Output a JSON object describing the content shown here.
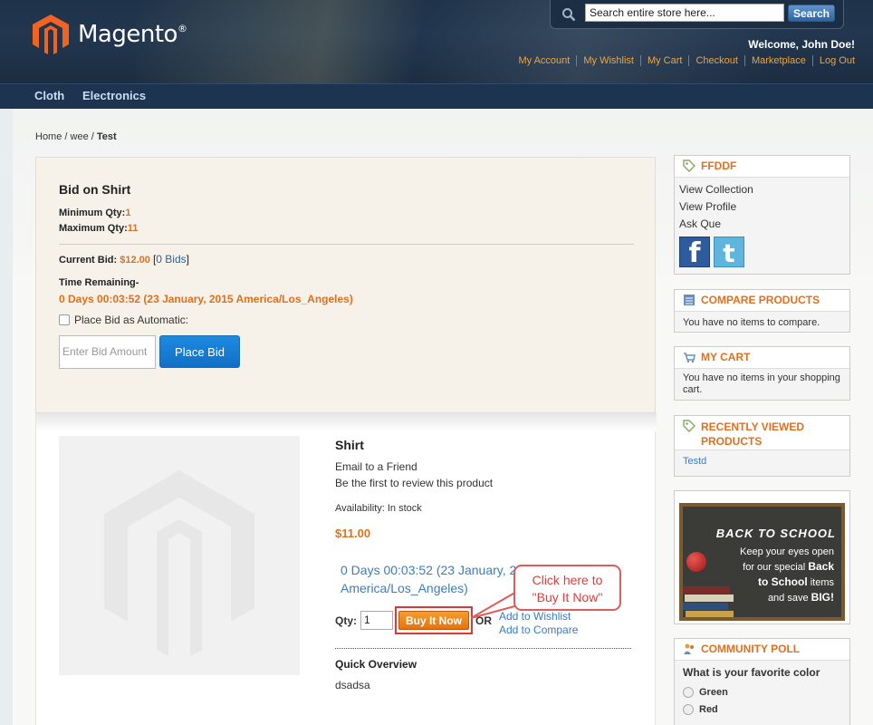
{
  "header": {
    "logo_text": "Magento",
    "logo_mark": "®",
    "search_placeholder": "Search entire store here...",
    "search_button": "Search",
    "welcome": "Welcome, John Doe!",
    "links": [
      "My Account",
      "My Wishlist",
      "My Cart",
      "Checkout",
      "Marketplace",
      "Log Out"
    ]
  },
  "nav": {
    "items": [
      "Cloth",
      "Electronics"
    ]
  },
  "breadcrumb": {
    "home": "Home",
    "sep1": " / ",
    "category": "wee",
    "sep2": " / ",
    "current": "Test"
  },
  "bid": {
    "title": "Bid on Shirt",
    "min_label": "Minimum Qty:",
    "min_value": "1",
    "max_label": "Maximum Qty:",
    "max_value": "11",
    "current_label": "Current Bid:",
    "current_value": "$12.00",
    "bids_open": "[",
    "bids_link": "0 Bids",
    "bids_close": "]",
    "time_label": "Time Remaining-",
    "time_value": "0 Days 00:03:52 (23 January, 2015 America/Los_Angeles)",
    "auto_label": "Place Bid as Automatic:",
    "amount_placeholder": "Enter Bid Amount",
    "place_button": "Place Bid"
  },
  "product": {
    "name": "Shirt",
    "email_friend": "Email to a Friend",
    "review": "Be the first to review this product",
    "availability": "Availability: In stock",
    "price": "$11.00",
    "timer_line1": "0 Days 00:03:52 (23 January, 20",
    "timer_line2": "America/Los_Angeles)",
    "qty_label": "Qty:",
    "qty_value": "1",
    "buy_button": "Buy It Now",
    "or_label": "OR",
    "wishlist_link": "Add to Wishlist",
    "compare_link": "Add to Compare",
    "overview_title": "Quick Overview",
    "overview_text": "dsadsa"
  },
  "callout": {
    "line1": "Click here to",
    "line2": "\"Buy It Now\""
  },
  "sidebar": {
    "seller": {
      "title": "FFDDF",
      "links": [
        "View Collection",
        "View Profile",
        "Ask Que"
      ]
    },
    "compare": {
      "title": "COMPARE PRODUCTS",
      "text": "You have no items to compare."
    },
    "cart": {
      "title": "MY CART",
      "text": "You have no items in your shopping cart."
    },
    "recent": {
      "title": "RECENTLY VIEWED PRODUCTS",
      "item": "Testd"
    },
    "promo": {
      "title": "BACK TO SCHOOL",
      "line1": "Keep your eyes open",
      "line2": "for our special",
      "highlight1": "Back",
      "highlight2": "to School",
      "line3": "items",
      "line4": "and save",
      "highlight3": "BIG!"
    },
    "poll": {
      "title": "COMMUNITY POLL",
      "question": "What is your favorite color",
      "options": [
        "Green",
        "Red"
      ]
    }
  },
  "colors": {
    "accent": "#e0701e",
    "link": "#3a7cc0",
    "header_bg": "#1e3249",
    "buy_button": "#ee8418"
  }
}
